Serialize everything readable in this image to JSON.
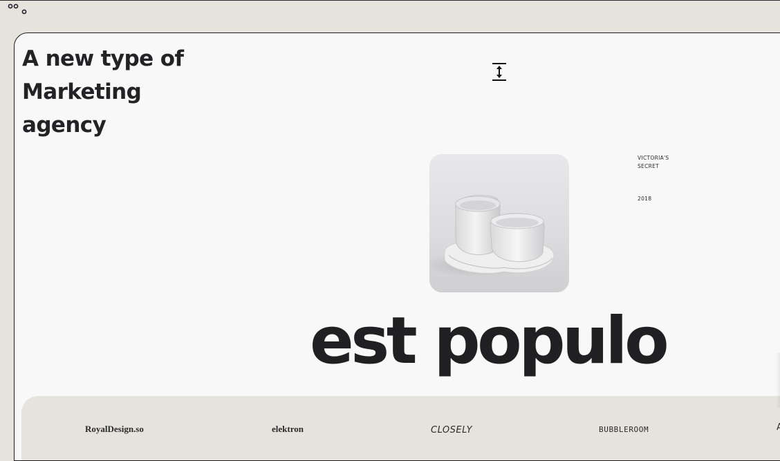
{
  "header": {
    "logo_icon": "three-circles-logo-icon"
  },
  "hero": {
    "headline": "A new type of Marketing agency",
    "resize_icon": "vertical-resize-icon",
    "image_alt": "White ceramic double cup set",
    "client": "VICTORIA'S SECRET",
    "year": "2018",
    "title": "est populo"
  },
  "brands": [
    "RoyalDesign.so",
    "elektron",
    "CLOSELY",
    "BUBBLEROOM",
    "A"
  ],
  "colors": {
    "background": "#e6e3dd",
    "card": "#f8f8f8",
    "text": "#202023"
  }
}
